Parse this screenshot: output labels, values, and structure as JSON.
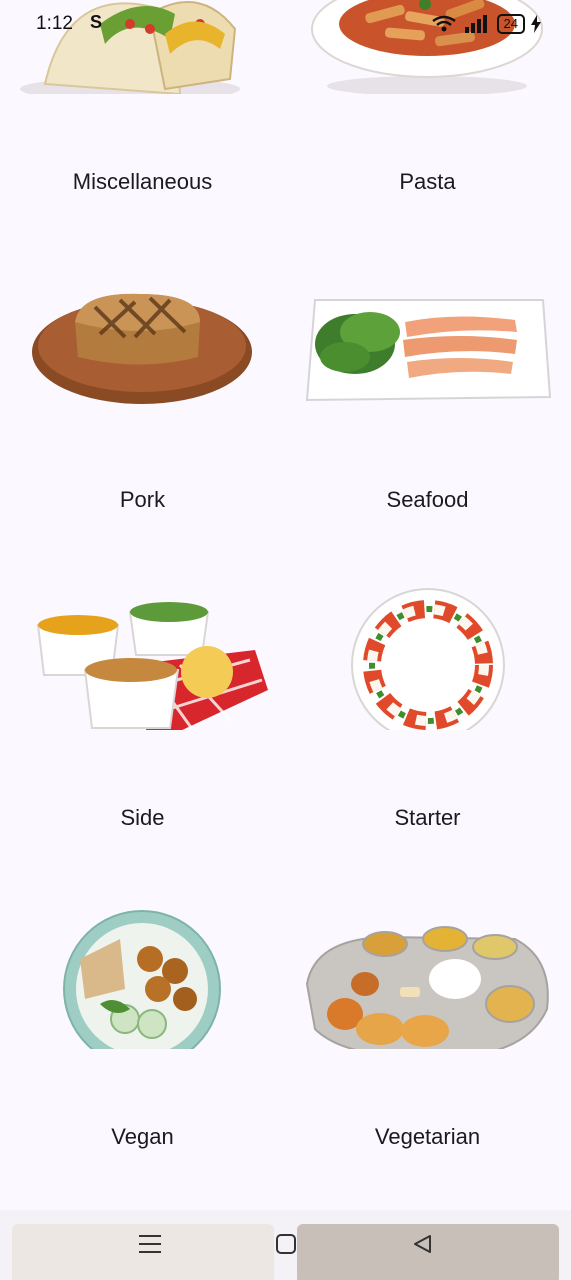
{
  "status_bar": {
    "time": "1:12",
    "carrier_icon": "S",
    "battery": "24"
  },
  "categories": [
    {
      "label": "Miscellaneous",
      "icon": "taco-image"
    },
    {
      "label": "Pasta",
      "icon": "pasta-image"
    },
    {
      "label": "Pork",
      "icon": "pork-steak-image"
    },
    {
      "label": "Seafood",
      "icon": "salmon-plate-image"
    },
    {
      "label": "Side",
      "icon": "side-dishes-image"
    },
    {
      "label": "Starter",
      "icon": "caprese-image"
    },
    {
      "label": "Vegan",
      "icon": "vegan-bowl-image"
    },
    {
      "label": "Vegetarian",
      "icon": "thali-image"
    }
  ],
  "nav": {
    "menu_icon": "menu-icon",
    "home_icon": "home-square-icon",
    "back_icon": "back-triangle-icon"
  }
}
